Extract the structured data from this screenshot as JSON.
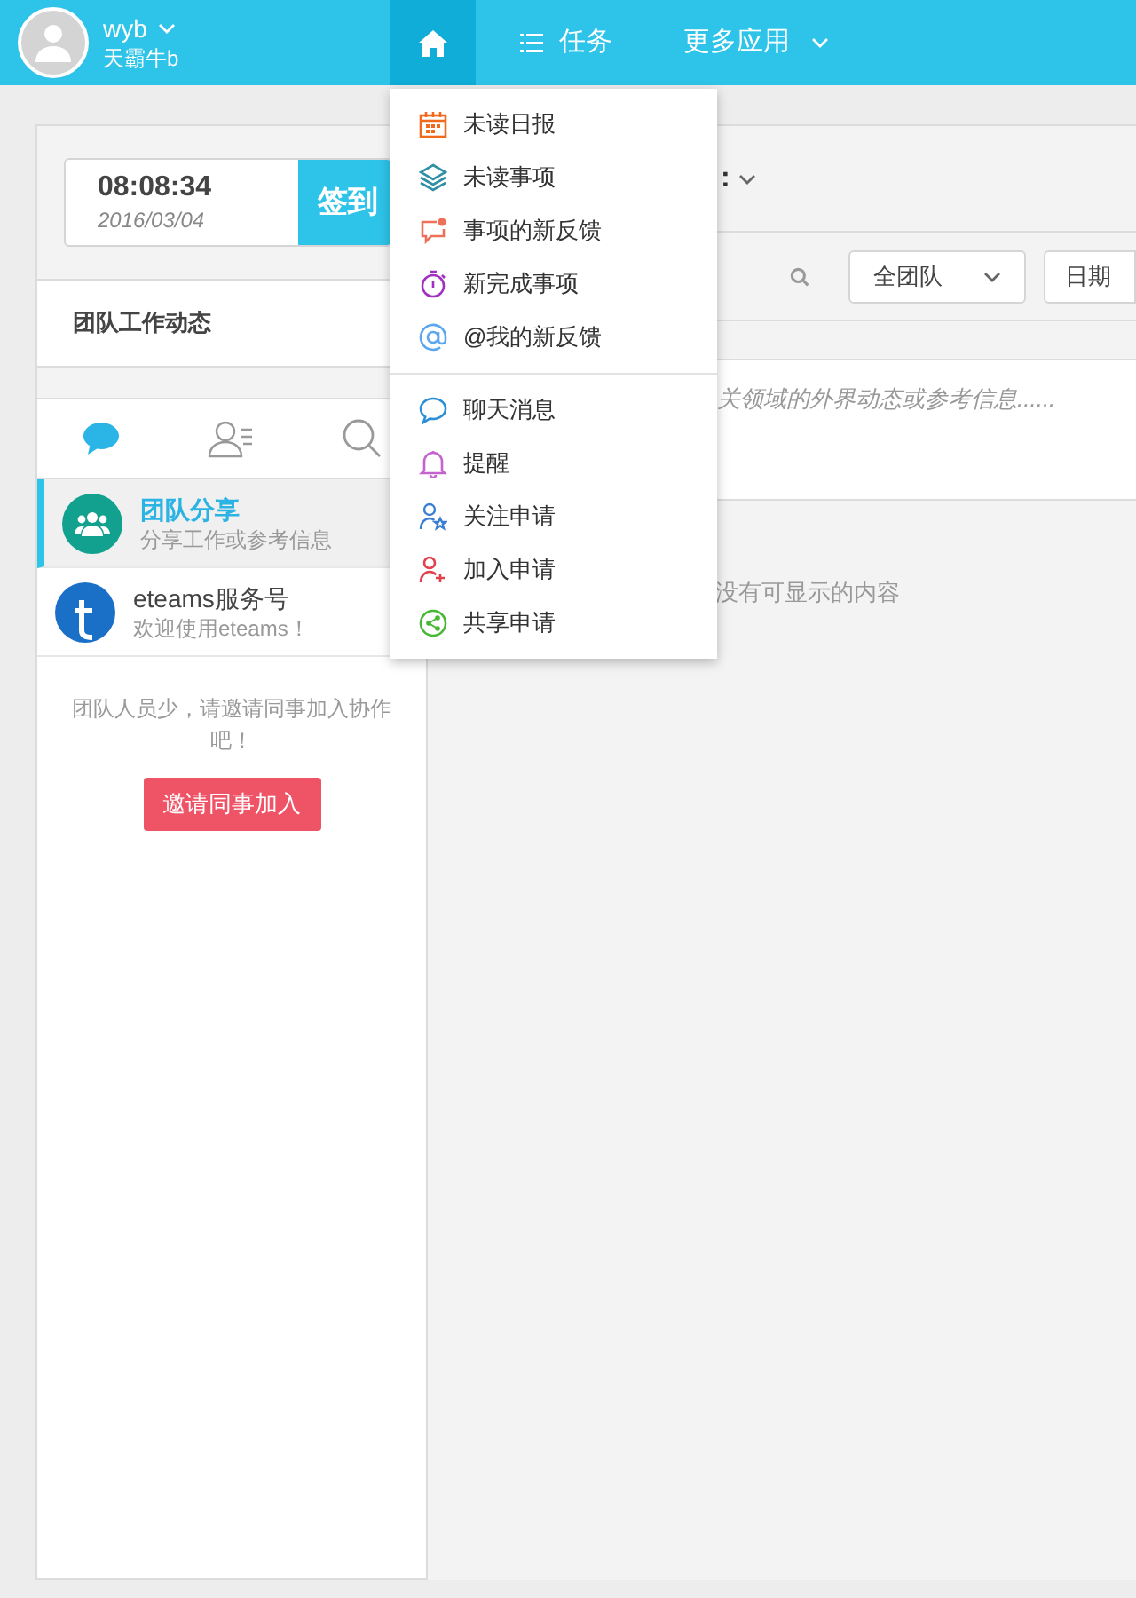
{
  "top_bar": {
    "user": {
      "name": "wyb",
      "team": "天霸牛b"
    },
    "nav": [
      {
        "kind": "home",
        "selected": true
      },
      {
        "kind": "tasks",
        "label": "任务",
        "selected": false
      },
      {
        "kind": "more",
        "label": "更多应用",
        "selected": false
      }
    ]
  },
  "dropdown": {
    "groups": [
      [
        {
          "kind": "calendar",
          "label": "未读日报"
        },
        {
          "kind": "layers",
          "label": "未读事项"
        },
        {
          "kind": "feedback",
          "label": "事项的新反馈"
        },
        {
          "kind": "timer",
          "label": "新完成事项"
        },
        {
          "kind": "at",
          "label": "@我的新反馈"
        }
      ],
      [
        {
          "kind": "chat",
          "label": "聊天消息"
        },
        {
          "kind": "bell",
          "label": "提醒"
        },
        {
          "kind": "follow",
          "label": "关注申请"
        },
        {
          "kind": "join",
          "label": "加入申请"
        },
        {
          "kind": "share",
          "label": "共享申请"
        }
      ]
    ]
  },
  "sidebar": {
    "clock": {
      "time": "08:08:34",
      "date": "2016/03/04"
    },
    "check_in_button": "签到",
    "section_title": "团队工作动态",
    "tabs": [
      {
        "kind": "chat",
        "selected": true
      },
      {
        "kind": "contacts",
        "selected": false
      },
      {
        "kind": "search",
        "selected": false
      }
    ],
    "conversations": [
      {
        "kind": "team",
        "title": "团队分享",
        "subtitle": "分享工作或参考信息",
        "selected": true
      },
      {
        "kind": "service",
        "title": "eteams服务号",
        "subtitle": "欢迎使用eteams！",
        "selected": false
      }
    ],
    "invite_hint": "团队人员少，请邀请同事加入协作吧！",
    "invite_button": "邀请同事加入"
  },
  "main": {
    "heading_fragment": ":",
    "filter": {
      "team_select": "全团队",
      "date_select": "日期"
    },
    "share_hint": "关领域的外界动态或参考信息......",
    "empty_text": "没有可显示的内容"
  }
}
